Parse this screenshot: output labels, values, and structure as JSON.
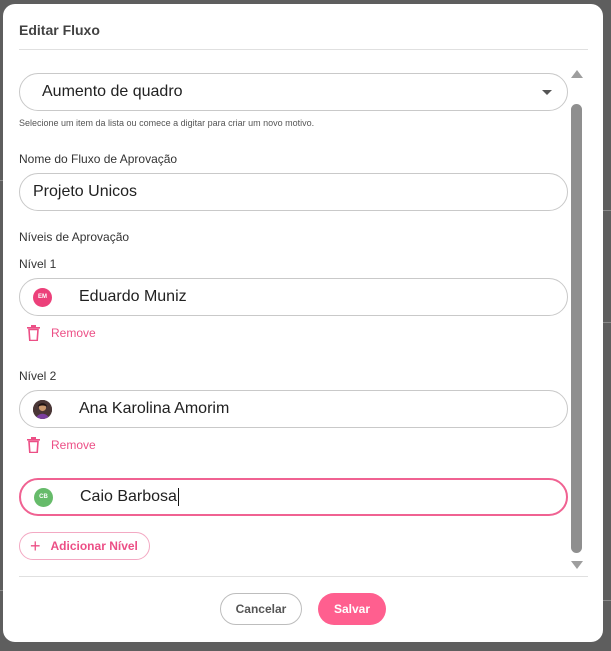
{
  "dialog": {
    "title": "Editar Fluxo",
    "reason_select": {
      "value": "Aumento de quadro",
      "helper": "Selecione um item da lista ou comece a digitar para criar um novo motivo."
    },
    "flow_name": {
      "label": "Nome do Fluxo de Aprovação",
      "value": "Projeto Unicos"
    },
    "levels_heading": "Níveis de Aprovação",
    "levels": [
      {
        "label": "Nível 1",
        "approver": "Eduardo Muniz",
        "initials": "EM",
        "avatar_color": "#ec407a",
        "remove_label": "Remove"
      },
      {
        "label": "Nível 2",
        "approver": "Ana Karolina Amorim",
        "initials": "",
        "avatar_color": "#3b2a2a",
        "remove_label": "Remove"
      },
      {
        "label": "",
        "approver": "Caio Barbosa",
        "initials": "CB",
        "avatar_color": "#66bb6a",
        "remove_label": ""
      }
    ],
    "add_level_label": "Adicionar Nível",
    "cancel_label": "Cancelar",
    "save_label": "Salvar"
  },
  "colors": {
    "accent": "#ec4f86",
    "save_button": "#ff5f8f",
    "focus_border": "#f06292"
  }
}
